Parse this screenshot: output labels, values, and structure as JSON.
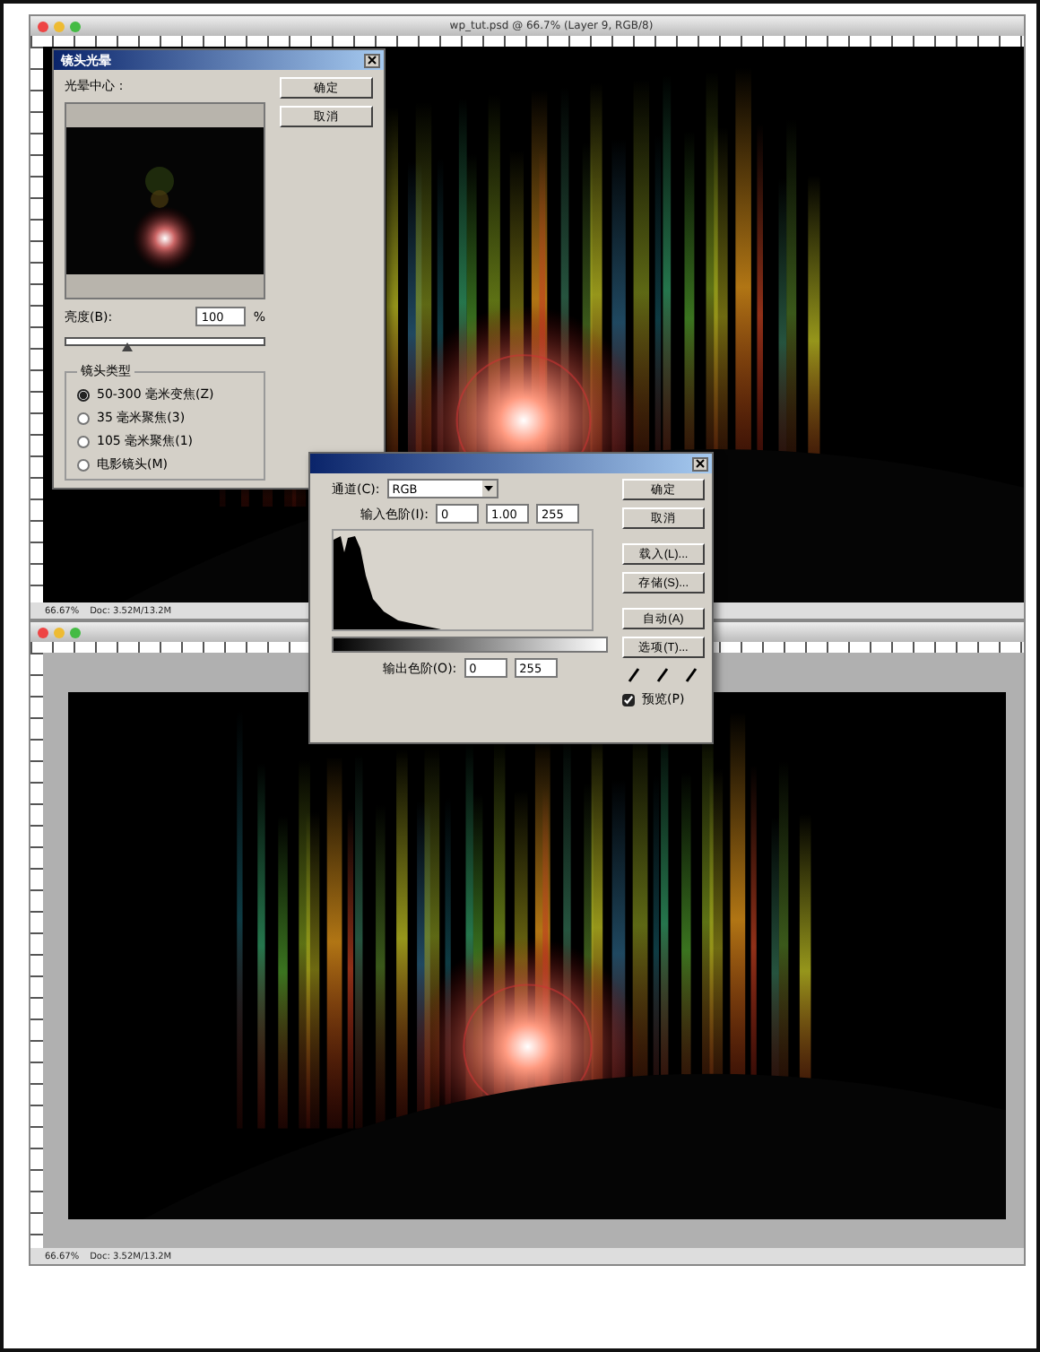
{
  "top_window": {
    "title": "wp_tut.psd @ 66.7% (Layer 9, RGB/8)",
    "zoom": "66.67%",
    "doc_info": "Doc: 3.52M/13.2M"
  },
  "bottom_window": {
    "zoom": "66.67%",
    "doc_info": "Doc: 3.52M/13.2M"
  },
  "lens_flare_dialog": {
    "title": "镜头光晕",
    "center_label": "光晕中心：",
    "buttons": [
      "确定",
      "取消"
    ],
    "brightness": {
      "label": "亮度(B):",
      "value": "100",
      "unit": "%",
      "level": 0.31
    },
    "lens_type": {
      "title": "镜头类型",
      "options": [
        {
          "label": "50-300 毫米变焦(Z)",
          "selected": true
        },
        {
          "label": "35 毫米聚焦(3)",
          "selected": false
        },
        {
          "label": "105 毫米聚焦(1)",
          "selected": false
        },
        {
          "label": "电影镜头(M)",
          "selected": false
        }
      ]
    }
  },
  "levels_dialog": {
    "channel_label": "通道(C):",
    "channel": "RGB",
    "input_label": "输入色阶(I):",
    "input_values": [
      "0",
      "1.00",
      "255"
    ],
    "output_label": "输出色阶(O):",
    "output_values": [
      "0",
      "255"
    ],
    "buttons": [
      "确定",
      "取消",
      "载入(L)...",
      "存储(S)...",
      "自动(A)",
      "选项(T)..."
    ],
    "preview": {
      "label": "预览(P)",
      "checked": true
    }
  }
}
